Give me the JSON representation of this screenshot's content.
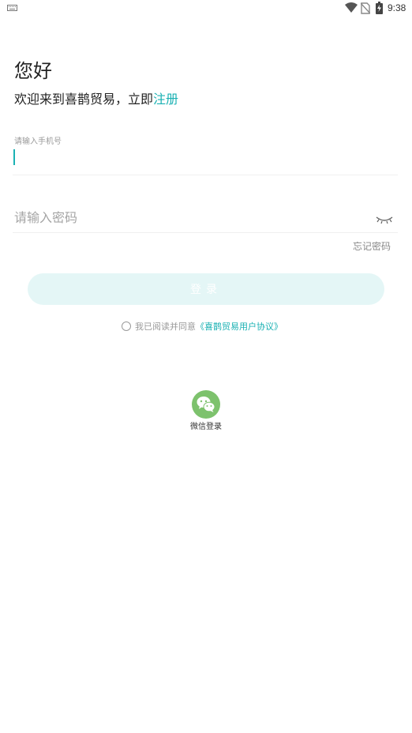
{
  "status_bar": {
    "time": "9:38",
    "icons": [
      "keyboard-icon",
      "wifi-icon",
      "no-sim-icon",
      "battery-charging-icon"
    ]
  },
  "header": {
    "title": "您好",
    "subtitle_prefix": "欢迎来到喜鹊贸易，立即",
    "register_label": "注册"
  },
  "phone_field": {
    "label": "请输入手机号",
    "value": ""
  },
  "password_field": {
    "placeholder": "请输入密码",
    "value": "",
    "toggle_icon": "eye-closed-icon"
  },
  "forgot_password_label": "忘记密码",
  "login_button_label": "登录",
  "agreement": {
    "checked": false,
    "prefix": "我已阅读并同意",
    "link_label": "《喜鹊贸易用户协议》"
  },
  "wechat_login": {
    "icon": "wechat-icon",
    "label": "微信登录"
  },
  "colors": {
    "accent": "#1ab1b3",
    "login_button_bg": "#e4f6f6",
    "wechat_green": "#7dc26d",
    "muted_text": "#9a9a9a"
  }
}
